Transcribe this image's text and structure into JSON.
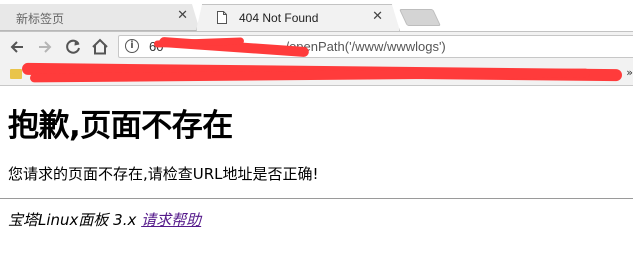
{
  "browser": {
    "tabs": [
      {
        "title": "新标签页",
        "close": "✕",
        "active": false
      },
      {
        "title": "404 Not Found",
        "close": "✕",
        "active": true
      }
    ],
    "address_bar": {
      "info_glyph": "i",
      "url_visible_start": "60",
      "url_visible_path": "/openPath('/www/wwwlogs')"
    },
    "bookmarks_overflow": "»",
    "redaction_color": "#ff3b3b"
  },
  "page": {
    "heading": "抱歉,页面不存在",
    "message": "您请求的页面不存在,请检查URL地址是否正确!",
    "footer_text": "宝塔Linux面板 3.x ",
    "help_link": "请求帮助",
    "link_color": "#551a8b"
  }
}
